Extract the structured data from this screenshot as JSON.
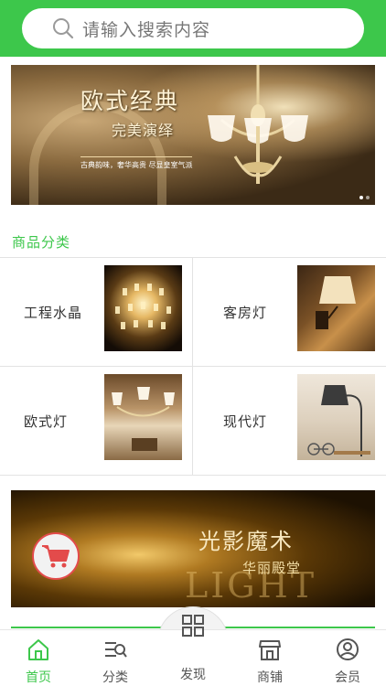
{
  "search": {
    "placeholder": "请输入搜索内容"
  },
  "banner": {
    "title": "欧式经典",
    "subtitle": "完美演绎",
    "tagline": "古典韵味，奢华高贵 尽显皇室气派"
  },
  "section": {
    "title": "商品分类"
  },
  "categories": [
    {
      "label": "工程水晶"
    },
    {
      "label": "客房灯"
    },
    {
      "label": "欧式灯"
    },
    {
      "label": "现代灯"
    }
  ],
  "promo": {
    "title": "光影魔术",
    "subtitle": "华丽殿堂",
    "light_text": "LIGHT"
  },
  "tabbar": {
    "items": [
      {
        "label": "首页",
        "icon": "home-icon"
      },
      {
        "label": "分类",
        "icon": "category-icon"
      },
      {
        "label": "发现",
        "icon": "grid-icon"
      },
      {
        "label": "商铺",
        "icon": "store-icon"
      },
      {
        "label": "会员",
        "icon": "user-icon"
      }
    ]
  },
  "colors": {
    "accent": "#3dc74b",
    "cart_badge": "#e34b4b"
  }
}
